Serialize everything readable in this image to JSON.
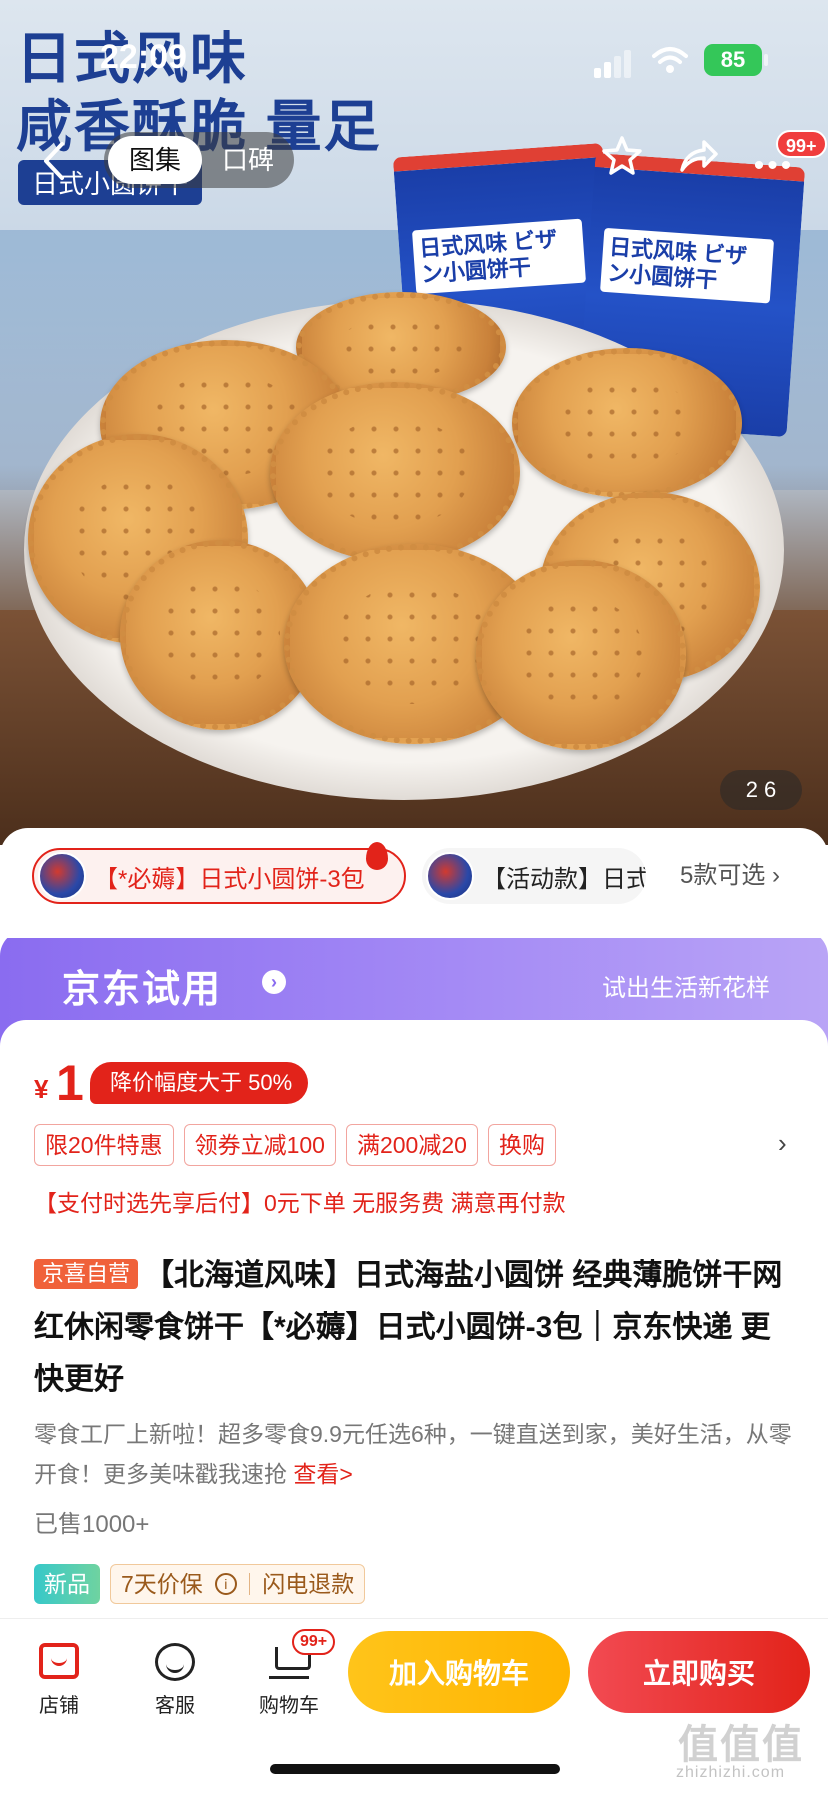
{
  "status_bar": {
    "time": "22:09",
    "battery": "85"
  },
  "hero": {
    "headline_line1": "日式风味",
    "headline_line2": "咸香酥脆 量足",
    "tag": "日式小圆饼干",
    "bag_text": "日式风味 ビザン小圆饼干",
    "image_counter": "2   6"
  },
  "nav": {
    "back_icon": "chevron-left-icon",
    "tabs": [
      {
        "label": "图集",
        "active": true
      },
      {
        "label": "口碑",
        "active": false
      }
    ],
    "more_badge": "99+"
  },
  "variants": {
    "selected": "【*必薅】日式小圆饼-3包",
    "other": "【活动款】日式小圆",
    "more": "5款可选 ›"
  },
  "trial": {
    "title": "京东试用",
    "arrow": "›",
    "slogan": "试出生活新花样"
  },
  "price": {
    "currency": "¥",
    "value": "1",
    "tag": "降价幅度大于 50%"
  },
  "promos": [
    "限20件特惠",
    "领券立减100",
    "满200减20",
    "换购"
  ],
  "promo_chevron": "›",
  "pay_later": "【支付时选先享后付】0元下单 无服务费 满意再付款",
  "product": {
    "self_tag": "京喜自营",
    "title": "【北海道风味】日式海盐小圆饼 经典薄脆饼干网红休闲零食饼干【*必薅】日式小圆饼-3包｜京东快递 更快更好",
    "desc": "零食工厂上新啦！超多零食9.9元任选6种，一键直送到家，美好生活，从零开食！更多美味戳我速抢 ",
    "desc_link": "查看>",
    "sold": "已售1000+"
  },
  "services": {
    "new": "新品",
    "guard": "7天价保",
    "info": "i",
    "refund": "闪电退款"
  },
  "bottom_bar": {
    "store": "店铺",
    "service": "客服",
    "cart": "购物车",
    "cart_badge": "99+",
    "add_cart": "加入购物车",
    "buy_now": "立即购买"
  },
  "watermark": {
    "main": "值值值",
    "sub": "zhizhizhi.com"
  },
  "colors": {
    "brand_red": "#e2231a",
    "trial_purple": "#8a6cf0",
    "cart_yellow": "#ffc41a"
  }
}
